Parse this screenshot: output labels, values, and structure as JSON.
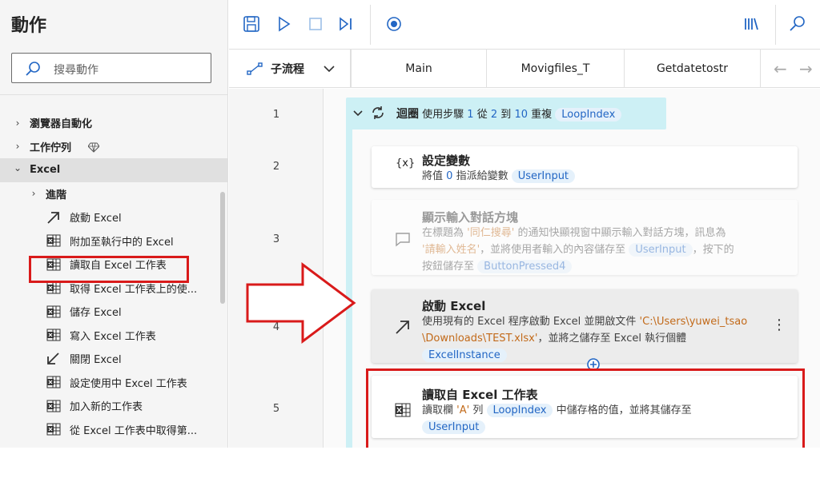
{
  "panel": {
    "title": "動作",
    "search_placeholder": "搜尋動作",
    "items": [
      {
        "label": "瀏覽器自動化",
        "chevron": "›"
      },
      {
        "label": "工作佇列",
        "chevron": "›",
        "badge_icon": "premium-diamond-icon"
      },
      {
        "label": "Excel",
        "chevron": "⌄"
      },
      {
        "label": "進階",
        "chevron": "›"
      },
      {
        "label": "啟動 Excel",
        "icon": "launch-arrow-icon"
      },
      {
        "label": "附加至執行中的 Excel",
        "icon": "excel-sheet-icon"
      },
      {
        "label": "讀取自 Excel 工作表",
        "icon": "excel-sheet-icon"
      },
      {
        "label": "取得 Excel 工作表上的使...",
        "icon": "excel-sheet-icon"
      },
      {
        "label": "儲存 Excel",
        "icon": "excel-sheet-icon"
      },
      {
        "label": "寫入 Excel 工作表",
        "icon": "excel-sheet-icon"
      },
      {
        "label": "關閉 Excel",
        "icon": "close-arrow-icon"
      },
      {
        "label": "設定使用中 Excel 工作表",
        "icon": "excel-sheet-icon"
      },
      {
        "label": "加入新的工作表",
        "icon": "excel-sheet-icon"
      },
      {
        "label": "從 Excel 工作表中取得第...",
        "icon": "excel-sheet-icon"
      }
    ]
  },
  "toolbar": {
    "buttons": [
      "save-icon",
      "run-icon",
      "stop-icon",
      "step-icon",
      "record-icon",
      "variables-icon",
      "search-icon"
    ]
  },
  "tabs": {
    "subflow_label": "子流程",
    "items": [
      "Main",
      "Movigfiles_T",
      "Getdatetostr"
    ],
    "arrows": [
      "←",
      "→"
    ]
  },
  "lines": [
    "1",
    "2",
    "3",
    "4",
    "5"
  ],
  "loop": {
    "title": "迴圈",
    "t1": "使用步驟",
    "step": "1",
    "t2": "從",
    "start": "2",
    "t3": "到",
    "end": "10",
    "t4": "重複",
    "var": "LoopIndex"
  },
  "steps": {
    "set_var": {
      "icon": "{x}",
      "title": "設定變數",
      "t1": "將值",
      "value": "0",
      "t2": "指派給變數",
      "var": "UserInput"
    },
    "input_dialog": {
      "title": "顯示輸入對話方塊",
      "t1": "在標題為",
      "title_str": "'同仁搜尋'",
      "t2": "的通知快顯視窗中顯示輸入對話方塊，訊息為",
      "msg_str": "'請輸入姓名'",
      "t3": "，並將使用者輸入的內容儲存至",
      "var1": "UserInput",
      "t4": "，按下的",
      "t5": "按鈕儲存至",
      "var2": "ButtonPressed4"
    },
    "launch_excel": {
      "title": "啟動 Excel",
      "t1": "使用現有的 Excel 程序啟動 Excel 並開啟文件",
      "path1": "'C:\\Users\\yuwei_tsao",
      "path2": "\\Downloads\\TEST.xlsx'",
      "t2": "，並將之儲存至 Excel 執行個體",
      "var": "ExcelInstance",
      "menu": "⋮"
    },
    "read_excel": {
      "title": "讀取自 Excel 工作表",
      "t1": "讀取欄",
      "col": "'A'",
      "t2": "列",
      "var1": "LoopIndex",
      "t3": "中儲存格的值，並將其儲存至",
      "var2": "UserInput"
    }
  },
  "colors": {
    "accent": "#2266c4",
    "loop_bg": "#cdf0f5",
    "highlight": "#d91a1a"
  }
}
